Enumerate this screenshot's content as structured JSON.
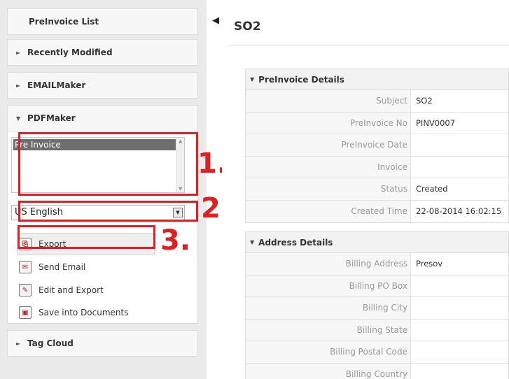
{
  "sidebar": {
    "preinvoice_list": "PreInvoice List",
    "recently_modified": "Recently Modified",
    "emailmaker": "EMAILMaker",
    "pdfmaker": {
      "title": "PDFMaker",
      "template_list": [
        "Pre Invoice"
      ],
      "language": "US English",
      "actions": {
        "export": "Export",
        "send_email": "Send Email",
        "edit_and_export": "Edit and Export",
        "save_into_documents": "Save into Documents"
      }
    },
    "tag_cloud": "Tag Cloud"
  },
  "annotations": {
    "one": "1.",
    "two": "2.",
    "three": "3."
  },
  "main": {
    "title": "SO2",
    "preinvoice_details": {
      "heading": "PreInvoice Details",
      "rows": [
        {
          "label": "Subject",
          "value": "SO2"
        },
        {
          "label": "PreInvoice No",
          "value": "PINV0007"
        },
        {
          "label": "PreInvoice Date",
          "value": ""
        },
        {
          "label": "Invoice",
          "value": ""
        },
        {
          "label": "Status",
          "value": "Created"
        },
        {
          "label": "Created Time",
          "value": "22-08-2014 16:02:15"
        }
      ]
    },
    "address_details": {
      "heading": "Address Details",
      "rows": [
        {
          "label": "Billing Address",
          "value": "Presov"
        },
        {
          "label": "Billing PO Box",
          "value": ""
        },
        {
          "label": "Billing City",
          "value": ""
        },
        {
          "label": "Billing State",
          "value": ""
        },
        {
          "label": "Billing Postal Code",
          "value": ""
        },
        {
          "label": "Billing Country",
          "value": ""
        }
      ]
    }
  },
  "colors": {
    "annotation_red": "#e02020",
    "sidebar_bg": "#eaeaea"
  }
}
